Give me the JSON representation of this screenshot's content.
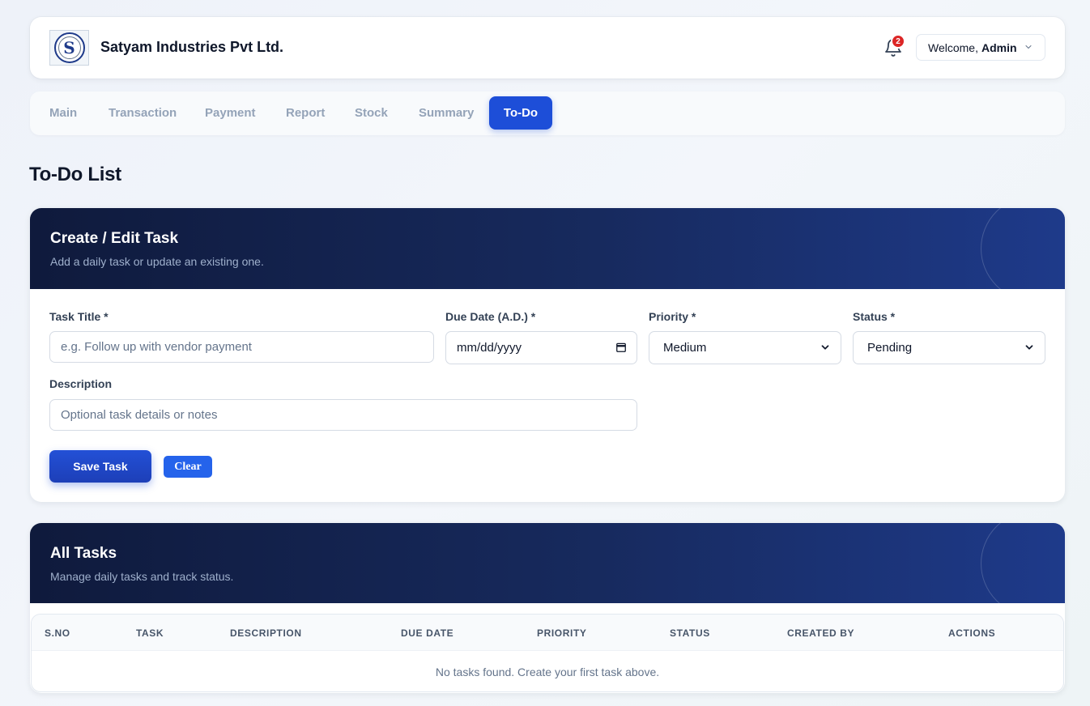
{
  "header": {
    "company_name": "Satyam Industries Pvt Ltd.",
    "notification_count": "2",
    "welcome_prefix": "Welcome,",
    "user_name": "Admin"
  },
  "nav": {
    "items": [
      {
        "label": "Main"
      },
      {
        "label": "Transaction"
      },
      {
        "label": "Payment"
      },
      {
        "label": "Report"
      },
      {
        "label": "Stock"
      },
      {
        "label": "Summary"
      },
      {
        "label": "To-Do",
        "active": true
      }
    ]
  },
  "page": {
    "title": "To-Do List"
  },
  "form_card": {
    "title": "Create / Edit Task",
    "subtitle": "Add a daily task or update an existing one.",
    "task_title": {
      "label": "Task Title *",
      "placeholder": "e.g. Follow up with vendor payment",
      "value": ""
    },
    "due_date": {
      "label": "Due Date (A.D.) *",
      "value": "mm/dd/yyyy"
    },
    "priority": {
      "label": "Priority *",
      "value": "Medium"
    },
    "status": {
      "label": "Status *",
      "value": "Pending"
    },
    "description": {
      "label": "Description",
      "placeholder": "Optional task details or notes",
      "value": ""
    },
    "save_label": "Save Task",
    "clear_label": "Clear"
  },
  "tasks_card": {
    "title": "All Tasks",
    "subtitle": "Manage daily tasks and track status.",
    "columns": [
      "S.NO",
      "TASK",
      "DESCRIPTION",
      "DUE DATE",
      "PRIORITY",
      "STATUS",
      "CREATED BY",
      "ACTIONS"
    ],
    "empty_message": "No tasks found. Create your first task above."
  },
  "colors": {
    "accent": "#1d4ed8",
    "badge": "#dc2626",
    "card_header_start": "#0f1a3c",
    "card_header_end": "#1e3a8a"
  },
  "icons": {
    "logo": "company-logo",
    "notifications": "bell-icon",
    "dropdown": "chevron-down-icon",
    "calendar": "calendar-icon"
  }
}
